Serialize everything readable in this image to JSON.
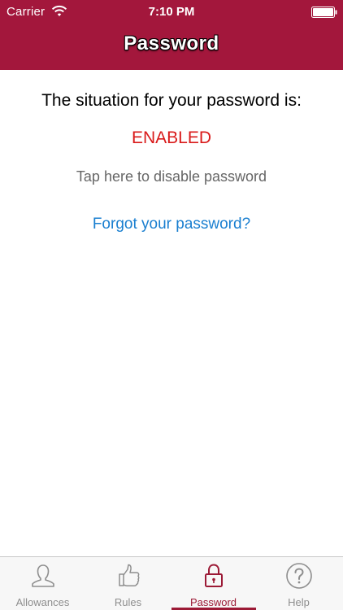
{
  "status_bar": {
    "carrier": "Carrier",
    "time": "7:10 PM"
  },
  "nav": {
    "title": "Password"
  },
  "main": {
    "situation_text": "The situation for your password is:",
    "status_value": "ENABLED",
    "disable_link": "Tap here to disable password",
    "forgot_link": "Forgot your password?"
  },
  "tab_bar": {
    "tabs": [
      {
        "label": "Allowances",
        "icon": "person-icon",
        "active": false
      },
      {
        "label": "Rules",
        "icon": "thumbs-up-icon",
        "active": false
      },
      {
        "label": "Password",
        "icon": "lock-icon",
        "active": true
      },
      {
        "label": "Help",
        "icon": "question-icon",
        "active": false
      }
    ]
  },
  "colors": {
    "brand": "#a3173c",
    "status_enabled": "#d91a1a",
    "link": "#1a7fd0",
    "tab_active": "#9c1a36",
    "tab_inactive": "#8e8e8e"
  }
}
